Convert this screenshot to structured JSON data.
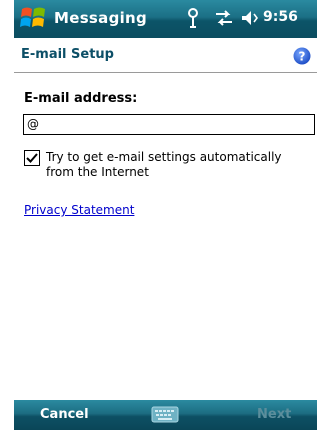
{
  "titlebar": {
    "app_title": "Messaging",
    "time": "9:56",
    "icons": [
      "start-menu-icon",
      "signal-antenna-icon",
      "connectivity-arrows-icon",
      "volume-icon"
    ]
  },
  "header": {
    "title": "E-mail Setup",
    "help_icon": "help-icon"
  },
  "form": {
    "email_label": "E-mail address:",
    "email_value": "@",
    "auto_settings_checked": true,
    "auto_settings_label": "Try to get e-mail settings automatically from the Internet",
    "privacy_link": "Privacy Statement"
  },
  "softkeys": {
    "left": "Cancel",
    "right": "Next",
    "right_enabled": false,
    "center_icon": "keyboard-icon"
  },
  "colors": {
    "bar_accent": "#0c5468",
    "header_text": "#0c4f67",
    "link": "#0000cc",
    "disabled_softkey": "#5b8e9c"
  }
}
